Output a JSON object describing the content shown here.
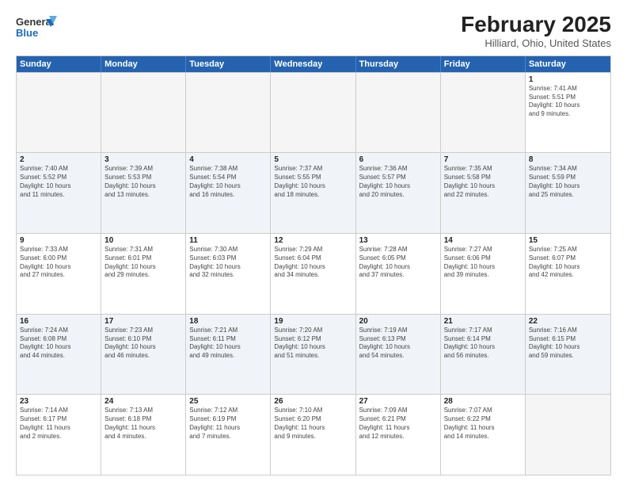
{
  "header": {
    "logo_line1": "General",
    "logo_line2": "Blue",
    "month": "February 2025",
    "location": "Hilliard, Ohio, United States"
  },
  "weekdays": [
    "Sunday",
    "Monday",
    "Tuesday",
    "Wednesday",
    "Thursday",
    "Friday",
    "Saturday"
  ],
  "rows": [
    [
      {
        "day": "",
        "info": ""
      },
      {
        "day": "",
        "info": ""
      },
      {
        "day": "",
        "info": ""
      },
      {
        "day": "",
        "info": ""
      },
      {
        "day": "",
        "info": ""
      },
      {
        "day": "",
        "info": ""
      },
      {
        "day": "1",
        "info": "Sunrise: 7:41 AM\nSunset: 5:51 PM\nDaylight: 10 hours\nand 9 minutes."
      }
    ],
    [
      {
        "day": "2",
        "info": "Sunrise: 7:40 AM\nSunset: 5:52 PM\nDaylight: 10 hours\nand 11 minutes."
      },
      {
        "day": "3",
        "info": "Sunrise: 7:39 AM\nSunset: 5:53 PM\nDaylight: 10 hours\nand 13 minutes."
      },
      {
        "day": "4",
        "info": "Sunrise: 7:38 AM\nSunset: 5:54 PM\nDaylight: 10 hours\nand 16 minutes."
      },
      {
        "day": "5",
        "info": "Sunrise: 7:37 AM\nSunset: 5:55 PM\nDaylight: 10 hours\nand 18 minutes."
      },
      {
        "day": "6",
        "info": "Sunrise: 7:36 AM\nSunset: 5:57 PM\nDaylight: 10 hours\nand 20 minutes."
      },
      {
        "day": "7",
        "info": "Sunrise: 7:35 AM\nSunset: 5:58 PM\nDaylight: 10 hours\nand 22 minutes."
      },
      {
        "day": "8",
        "info": "Sunrise: 7:34 AM\nSunset: 5:59 PM\nDaylight: 10 hours\nand 25 minutes."
      }
    ],
    [
      {
        "day": "9",
        "info": "Sunrise: 7:33 AM\nSunset: 6:00 PM\nDaylight: 10 hours\nand 27 minutes."
      },
      {
        "day": "10",
        "info": "Sunrise: 7:31 AM\nSunset: 6:01 PM\nDaylight: 10 hours\nand 29 minutes."
      },
      {
        "day": "11",
        "info": "Sunrise: 7:30 AM\nSunset: 6:03 PM\nDaylight: 10 hours\nand 32 minutes."
      },
      {
        "day": "12",
        "info": "Sunrise: 7:29 AM\nSunset: 6:04 PM\nDaylight: 10 hours\nand 34 minutes."
      },
      {
        "day": "13",
        "info": "Sunrise: 7:28 AM\nSunset: 6:05 PM\nDaylight: 10 hours\nand 37 minutes."
      },
      {
        "day": "14",
        "info": "Sunrise: 7:27 AM\nSunset: 6:06 PM\nDaylight: 10 hours\nand 39 minutes."
      },
      {
        "day": "15",
        "info": "Sunrise: 7:25 AM\nSunset: 6:07 PM\nDaylight: 10 hours\nand 42 minutes."
      }
    ],
    [
      {
        "day": "16",
        "info": "Sunrise: 7:24 AM\nSunset: 6:08 PM\nDaylight: 10 hours\nand 44 minutes."
      },
      {
        "day": "17",
        "info": "Sunrise: 7:23 AM\nSunset: 6:10 PM\nDaylight: 10 hours\nand 46 minutes."
      },
      {
        "day": "18",
        "info": "Sunrise: 7:21 AM\nSunset: 6:11 PM\nDaylight: 10 hours\nand 49 minutes."
      },
      {
        "day": "19",
        "info": "Sunrise: 7:20 AM\nSunset: 6:12 PM\nDaylight: 10 hours\nand 51 minutes."
      },
      {
        "day": "20",
        "info": "Sunrise: 7:19 AM\nSunset: 6:13 PM\nDaylight: 10 hours\nand 54 minutes."
      },
      {
        "day": "21",
        "info": "Sunrise: 7:17 AM\nSunset: 6:14 PM\nDaylight: 10 hours\nand 56 minutes."
      },
      {
        "day": "22",
        "info": "Sunrise: 7:16 AM\nSunset: 6:15 PM\nDaylight: 10 hours\nand 59 minutes."
      }
    ],
    [
      {
        "day": "23",
        "info": "Sunrise: 7:14 AM\nSunset: 6:17 PM\nDaylight: 11 hours\nand 2 minutes."
      },
      {
        "day": "24",
        "info": "Sunrise: 7:13 AM\nSunset: 6:18 PM\nDaylight: 11 hours\nand 4 minutes."
      },
      {
        "day": "25",
        "info": "Sunrise: 7:12 AM\nSunset: 6:19 PM\nDaylight: 11 hours\nand 7 minutes."
      },
      {
        "day": "26",
        "info": "Sunrise: 7:10 AM\nSunset: 6:20 PM\nDaylight: 11 hours\nand 9 minutes."
      },
      {
        "day": "27",
        "info": "Sunrise: 7:09 AM\nSunset: 6:21 PM\nDaylight: 11 hours\nand 12 minutes."
      },
      {
        "day": "28",
        "info": "Sunrise: 7:07 AM\nSunset: 6:22 PM\nDaylight: 11 hours\nand 14 minutes."
      },
      {
        "day": "",
        "info": ""
      }
    ]
  ]
}
